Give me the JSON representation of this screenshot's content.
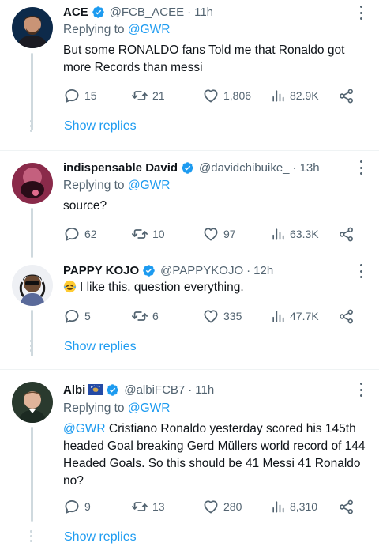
{
  "tweets": [
    {
      "name": "ACE",
      "handle": "@FCB_ACEE",
      "time": "11h",
      "replying_prefix": "Replying to ",
      "replying_to": "@GWR",
      "text": "But some RONALDO fans Told me that Ronaldo got more Records than messi",
      "replies": "15",
      "retweets": "21",
      "likes": "1,806",
      "views": "82.9K",
      "show_replies": "Show replies"
    },
    {
      "name": "indispensable David",
      "handle": "@davidchibuike_",
      "time": "13h",
      "replying_prefix": "Replying to ",
      "replying_to": "@GWR",
      "text": "source?",
      "replies": "62",
      "retweets": "10",
      "likes": "97",
      "views": "63.3K"
    },
    {
      "name": "PAPPY KOJO",
      "handle": "@PAPPYKOJO",
      "time": "12h",
      "text": "I like this. question everything.",
      "emoji": "laughing-with-tears",
      "replies": "5",
      "retweets": "6",
      "likes": "335",
      "views": "47.7K",
      "show_replies": "Show replies"
    },
    {
      "name": "Albi",
      "flag": "kosovo-flag",
      "handle": "@albiFCB7",
      "time": "11h",
      "replying_prefix": "Replying to ",
      "replying_to": "@GWR",
      "text_mention": "@GWR",
      "text": " Cristiano Ronaldo yesterday scored his 145th headed Goal breaking Gerd Müllers world record of 144 Headed Goals. So this should be 41 Messi 41 Ronaldo no?",
      "replies": "9",
      "retweets": "13",
      "likes": "280",
      "views": "8,310",
      "show_replies": "Show replies"
    }
  ],
  "colors": {
    "accent": "#1d9bf0",
    "secondary_text": "#536471",
    "primary_text": "#0f1419",
    "divider": "#eff3f4",
    "thread_line": "#cfd9de"
  },
  "separator": "·"
}
